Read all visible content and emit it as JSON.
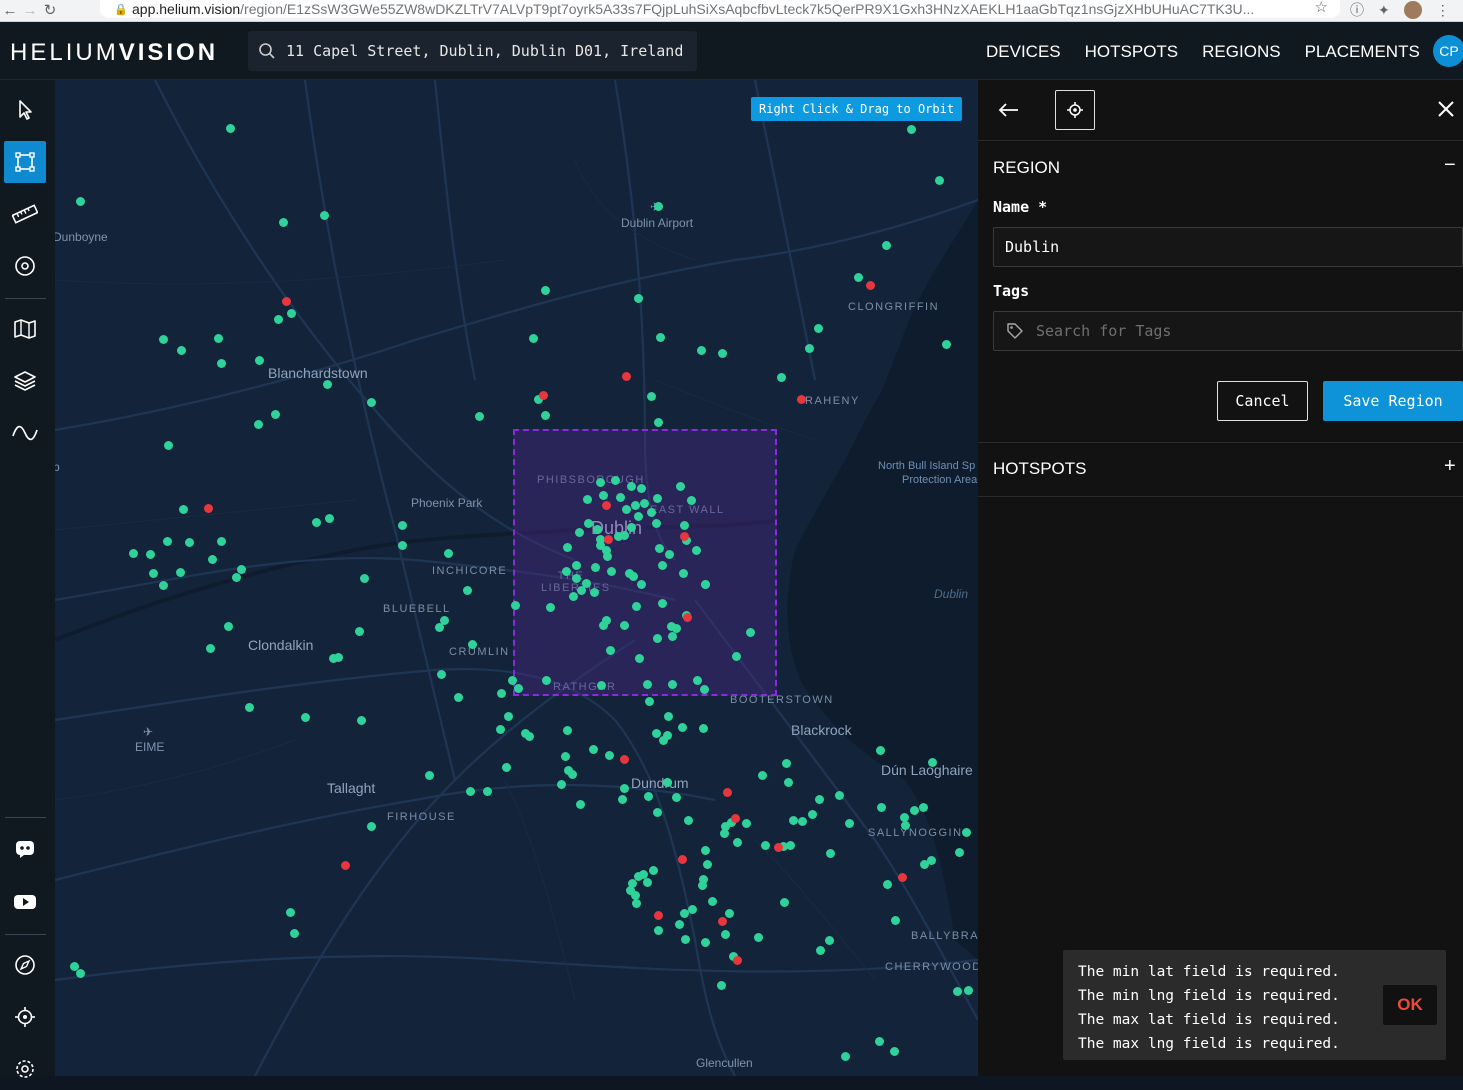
{
  "browser": {
    "url_host": "app.helium.vision",
    "url_path": "/region/E1zSsW3GWe55ZW8wDKZLTrV7ALVpT9pt7oyrk5A33s7FQjpLuhSiXsAqbcfbvLteck7k5QerPR9X1Gxh3HNzXAEKLH1aaGbTqz1nsGjzXHbUHuAC7TK3U..."
  },
  "header": {
    "logo_light": "HELIUM",
    "logo_bold": "VISION",
    "search_value": "11 Capel Street, Dublin, Dublin D01, Ireland",
    "nav": [
      "DEVICES",
      "HOTSPOTS",
      "REGIONS",
      "PLACEMENTS"
    ],
    "user_initials": "CP"
  },
  "toolbar": {
    "tools": [
      "pointer-icon",
      "draw-region-icon",
      "ruler-icon",
      "radius-icon",
      "map-icon",
      "layers-icon",
      "wave-icon"
    ],
    "active_tool": "draw-region-icon",
    "bottom": [
      "discord-icon",
      "youtube-icon",
      "compass-icon",
      "locate-icon",
      "settings-icon"
    ]
  },
  "map": {
    "orbit_hint": "Right Click & Drag to Orbit",
    "labels": {
      "dublin_airport": "Dublin Airport",
      "dunboyne": "Dunboyne",
      "blanchardstown": "Blanchardstown",
      "phoenix_park": "Phoenix Park",
      "phibsborough": "PHIBSBOROUGH",
      "dublin": "Dublin",
      "east_wall": "EAST WALL",
      "the_liberties": "THE LIBERTIES",
      "inchicore": "INCHICORE",
      "bluebell": "BLUEBELL",
      "clondalkin": "Clondalkin",
      "crumlin": "CRUMLIN",
      "rathgar": "RATHGAR",
      "booterstown": "BOOTERSTOWN",
      "blackrock": "Blackrock",
      "eime": "EIME",
      "tallaght": "Tallaght",
      "firhouse": "FIRHOUSE",
      "dundrum": "Dundrum",
      "dun_laoghaire": "Dún Laoghaire",
      "sallynoggin": "SALLYNOGGIN",
      "ballybrack": "BALLYBRA",
      "cherrywood": "CHERRYWOOD",
      "glencullen": "Glencullen",
      "clongriffin": "CLONGRIFFIN",
      "raheny": "RAHENY",
      "north_bull": "North Bull Island Sp",
      "protection": "Protection Area",
      "dublin_bay": "Dublin",
      "p": "p"
    },
    "hotspot_colors": {
      "online": "#2fd39a",
      "offline": "#e8363d"
    }
  },
  "panel": {
    "region_title": "REGION",
    "name_label": "Name *",
    "name_value": "Dublin",
    "tags_label": "Tags",
    "tags_placeholder": "Search for Tags",
    "cancel_label": "Cancel",
    "save_label": "Save Region",
    "hotspots_title": "HOTSPOTS",
    "collapse_symbol": "−",
    "expand_symbol": "+"
  },
  "toast": {
    "messages": [
      "The min lat field is required.",
      "The min lng field is required.",
      "The max lat field is required.",
      "The max lng field is required."
    ],
    "ok_label": "OK"
  }
}
